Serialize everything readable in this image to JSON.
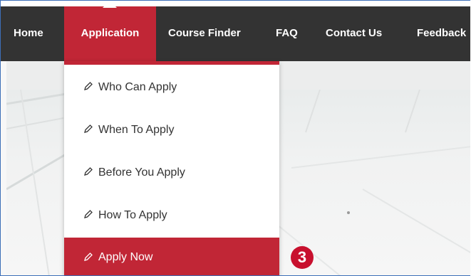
{
  "nav": {
    "items": [
      {
        "label": "Home"
      },
      {
        "label": "Application"
      },
      {
        "label": "Course Finder"
      },
      {
        "label": "FAQ"
      },
      {
        "label": "Contact Us"
      },
      {
        "label": "Feedback"
      }
    ],
    "active_index": 1
  },
  "dropdown": {
    "items": [
      {
        "label": "Who Can Apply",
        "icon": "pencil-icon"
      },
      {
        "label": "When To Apply",
        "icon": "pencil-icon"
      },
      {
        "label": "Before You Apply",
        "icon": "pencil-icon"
      },
      {
        "label": "How To Apply",
        "icon": "pencil-icon"
      },
      {
        "label": "Apply Now",
        "icon": "pencil-icon"
      }
    ],
    "active_index": 4
  },
  "annotation": {
    "step_badge": "3"
  },
  "colors": {
    "navbar_bg": "#333333",
    "accent_red": "#c12636",
    "badge_red": "#c8102e",
    "frame_border": "#3d6fb8"
  }
}
